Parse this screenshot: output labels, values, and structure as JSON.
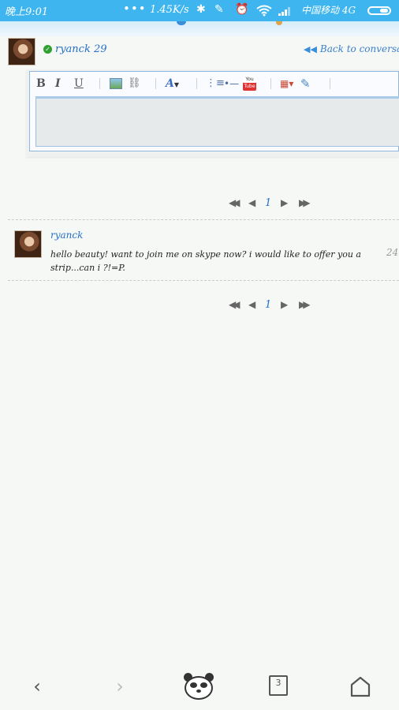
{
  "status_bar": {
    "time": "晚上9:01",
    "dots": "•••",
    "speed": "1.45K/s",
    "carrier": "中国移动 4G",
    "icons": [
      "bluetooth-icon",
      "mute-icon",
      "alarm-icon",
      "wifi-icon",
      "signal-icon",
      "battery-icon"
    ]
  },
  "header": {
    "username": "ryanck 29",
    "back_link": "Back to conversati"
  },
  "editor": {
    "toolbar": {
      "bold": "B",
      "italic": "I",
      "underline": "U",
      "font": "A",
      "list": "⋮≡",
      "hr": "•—",
      "youtube_top": "You",
      "youtube_bottom": "Tube",
      "table": "▦▾",
      "clear": "✎"
    },
    "text": ""
  },
  "pagination": {
    "first": "◀◀",
    "prev": "◀",
    "page": "1",
    "next": "▶",
    "last": "▶▶"
  },
  "message": {
    "author": "ryanck",
    "text": "hello beauty! want to join me on skype now? i would like to offer you a strip...can i ?!=P.",
    "time": "24"
  },
  "bottom_nav": {
    "back": "‹",
    "forward": "›",
    "tabs_count": "3"
  }
}
